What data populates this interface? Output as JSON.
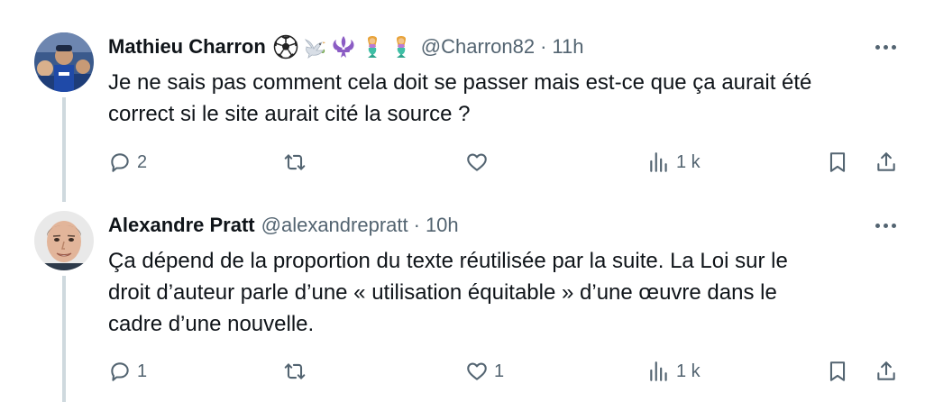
{
  "tweets": [
    {
      "author": "Mathieu Charron",
      "emojis": [
        "soccer-ball-emoji",
        "dove-emoji",
        "fleur-de-lis-emoji",
        "mermaid-emoji",
        "mermaid-emoji"
      ],
      "handle": "@Charron82",
      "separator": "·",
      "time": "11h",
      "text_lines": [
        "Je ne sais pas comment cela doit se passer mais est-ce que ça aurait été",
        "correct si le site aurait cité la source ?"
      ],
      "actions": {
        "replies": "2",
        "reposts": "",
        "likes": "",
        "views": "1 k"
      }
    },
    {
      "author": "Alexandre Pratt",
      "handle": "@alexandrepratt",
      "separator": "·",
      "time": "10h",
      "text_lines": [
        "Ça dépend de la proportion du texte réutilisée par la suite. La Loi sur le",
        "droit d’auteur parle d’une « utilisation équitable » d’une œuvre dans le",
        "cadre d’une nouvelle."
      ],
      "actions": {
        "replies": "1",
        "reposts": "",
        "likes": "1",
        "views": "1 k"
      }
    }
  ],
  "colors": {
    "text": "#0f1419",
    "muted": "#536471",
    "thread": "#cfd9de"
  }
}
